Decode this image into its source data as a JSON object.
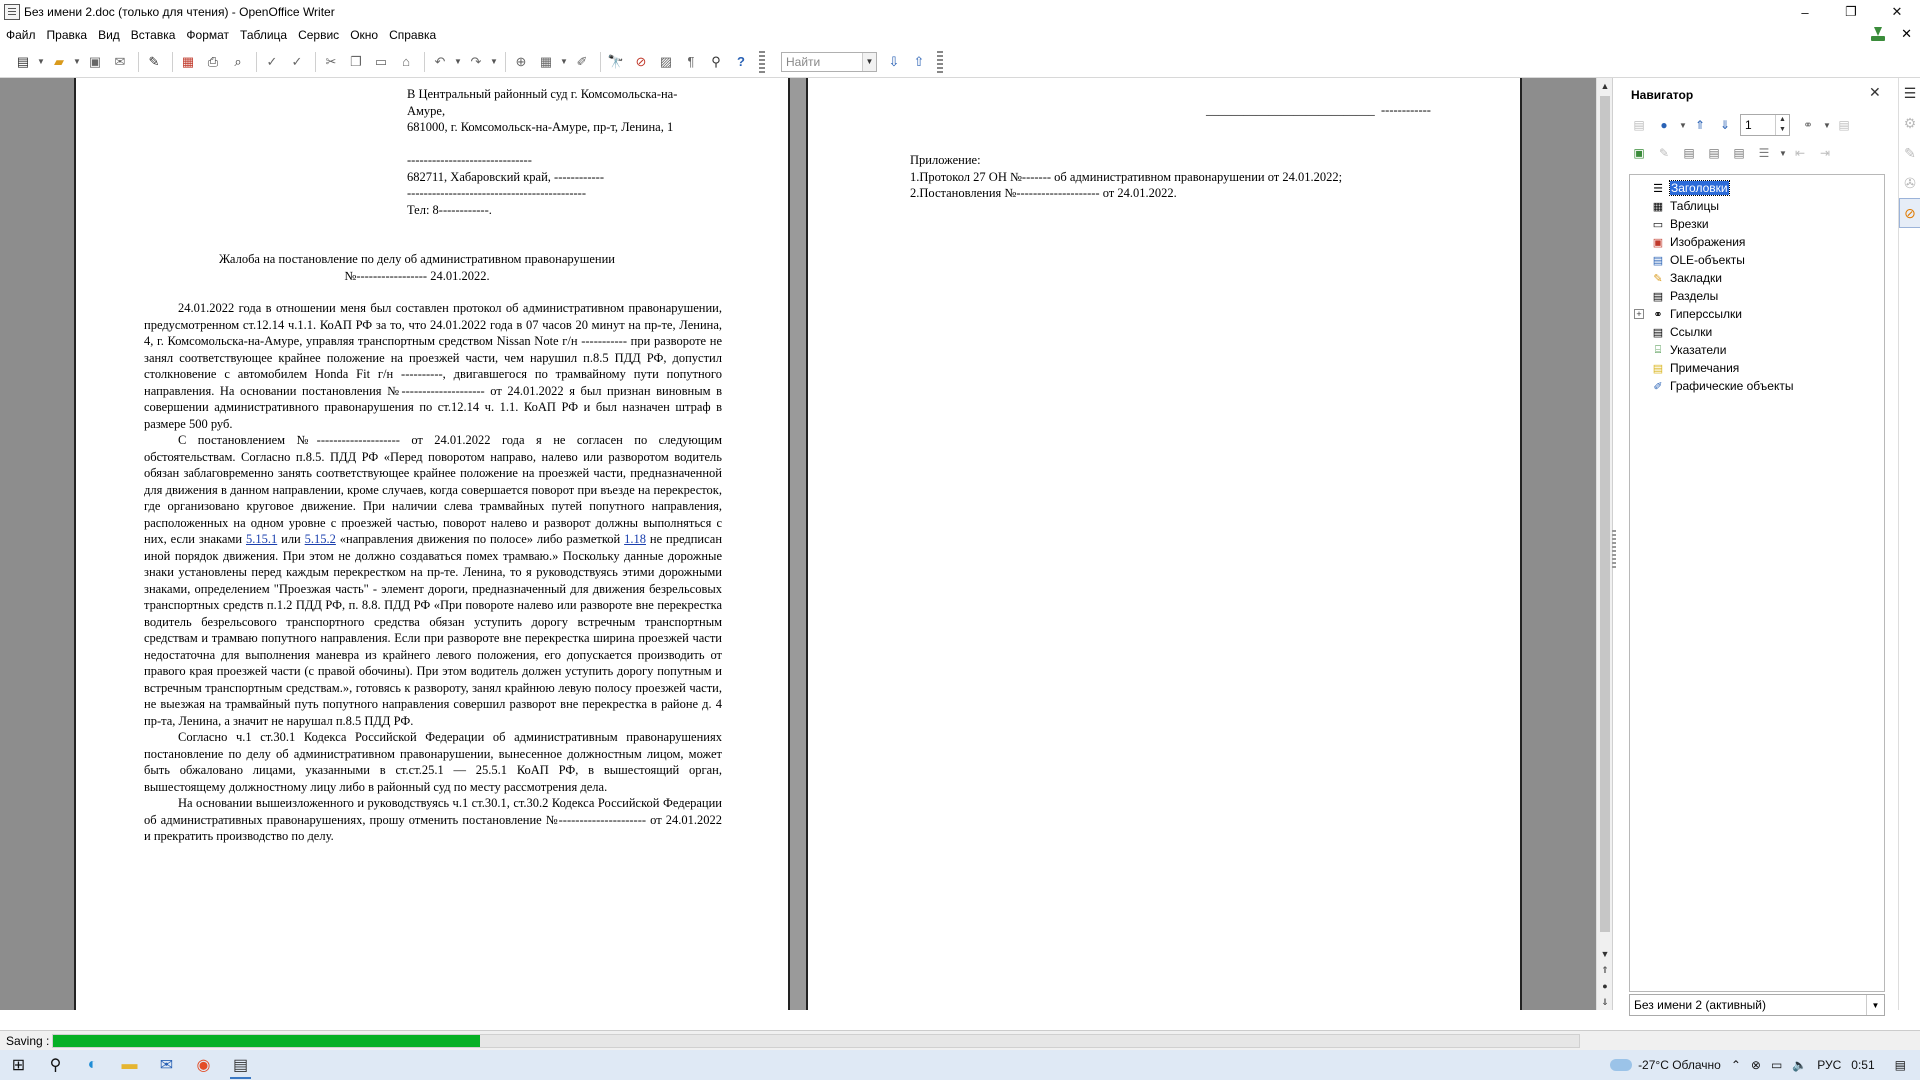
{
  "window": {
    "title": "Без имени 2.doc (только для чтения) - OpenOffice Writer",
    "minimize": "–",
    "maximize": "❐",
    "close": "✕"
  },
  "menu": [
    "Файл",
    "Правка",
    "Вид",
    "Вставка",
    "Формат",
    "Таблица",
    "Сервис",
    "Окно",
    "Справка"
  ],
  "toolbar": {
    "search_placeholder": "Найти"
  },
  "document": {
    "page1": {
      "address": [
        "В Центральный районный суд г. Комсомольска-на-",
        "Амуре,",
        "681000, г. Комсомольск-на-Амуре, пр-т, Ленина, 1",
        "",
        "------------------------------",
        "682711, Хабаровский край, ------------",
        "-------------------------------------------",
        "Тел: 8------------."
      ],
      "heading_line1": "Жалоба на постановление по делу об административном правонарушении",
      "heading_line2": "№----------------- 24.01.2022.",
      "paragraph1": "24.01.2022 года в отношении меня был составлен протокол об административном правонарушении, предусмотренном ст.12.14 ч.1.1. КоАП РФ за то, что 24.01.2022 года в 07 часов 20 минут на пр-те, Ленина, 4, г. Комсомольска-на-Амуре, управляя транспортным средством Nissan Note г/н ----------- при развороте не занял соответствующее крайнее положение на проезжей части, чем нарушил п.8.5 ПДД РФ, допустил столкновение с автомобилем Honda Fit г/н ----------, двигавшегося по трамвайному пути попутного направления. На основании постановления №-------------------- от 24.01.2022 я был признан виновным в совершении административного правонарушения по ст.12.14 ч. 1.1. КоАП РФ и был назначен штраф в размере 500 руб.",
      "paragraph2_a": "С постановлением №-------------------- от 24.01.2022 года я не согласен по следующим обстоятельствам. Согласно п.8.5. ПДД РФ «Перед поворотом направо, налево или разворотом водитель обязан заблаговременно занять соответствующее крайнее положение на проезжей части, предназначенной для движения в данном направлении, кроме случаев, когда совершается поворот при въезде на перекресток, где организовано круговое движение. При наличии слева трамвайных путей попутного направления, расположенных на одном уровне с проезжей частью, поворот налево и разворот должны выполняться с них, если знаками ",
      "link1": "5.15.1",
      "paragraph2_b": " или ",
      "link2": "5.15.2",
      "paragraph2_c": " «направления движения по полосе» либо разметкой ",
      "link3": "1.18",
      "paragraph2_d": " не предписан иной порядок движения. При этом не должно создаваться помех трамваю.» Поскольку данные дорожные знаки установлены перед каждым перекрестком на пр-те. Ленина, то я руководствуясь этими дорожными знаками, определением \"Проезжая часть\" - элемент дороги, предназначенный для движения безрельсовых транспортных средств п.1.2 ПДД РФ, п. 8.8. ПДД РФ «При повороте налево или развороте вне перекрестка водитель безрельсового транспортного средства обязан уступить дорогу встречным транспортным средствам и трамваю попутного направления. Если при развороте вне перекрестка ширина проезжей части недостаточна для выполнения маневра из крайнего левого положения, его допускается производить от правого края проезжей части (с правой обочины). При этом водитель должен уступить дорогу попутным и встречным транспортным средствам.», готовясь к развороту, занял крайнюю левую полосу проезжей части, не выезжая на трамвайный путь попутного направления совершил разворот вне перекрестка в районе д. 4 пр-та, Ленина, а значит не нарушал п.8.5 ПДД РФ.",
      "paragraph3": "Согласно ч.1 ст.30.1 Кодекса Российской Федерации об административным правонарушениях постановление по делу об административном правонарушении, вынесенное должностным лицом, может быть обжаловано лицами, указанными в ст.ст.25.1 — 25.5.1 КоАП РФ, в вышестоящий орган, вышестоящему должностному лицу либо в районный суд по месту рассмотрения дела.",
      "paragraph4": "На основании вышеизложенного и руководствуясь ч.1 ст.30.1, ст.30.2 Кодекса Российской Федерации об административных правонарушениях, прошу отменить постановление №--------------------- от 24.01.2022 и прекратить производство по делу."
    },
    "page2": {
      "signature_line": "___________________________  ------------",
      "attachments_title": "Приложение:",
      "attachment1": "1.Протокол 27 ОН №------- об административном правонарушении от 24.01.2022;",
      "attachment2": "2.Постановления №-------------------- от 24.01.2022."
    }
  },
  "navigator": {
    "title": "Навигатор",
    "page_number": "1",
    "items": [
      {
        "label": "Заголовки",
        "icon": "headings-icon",
        "selected": true
      },
      {
        "label": "Таблицы",
        "icon": "table-icon"
      },
      {
        "label": "Врезки",
        "icon": "frame-icon"
      },
      {
        "label": "Изображения",
        "icon": "image-icon"
      },
      {
        "label": "OLE-объекты",
        "icon": "ole-icon"
      },
      {
        "label": "Закладки",
        "icon": "bookmark-icon"
      },
      {
        "label": "Разделы",
        "icon": "section-icon"
      },
      {
        "label": "Гиперссылки",
        "icon": "hyperlink-icon",
        "expandable": true
      },
      {
        "label": "Ссылки",
        "icon": "reference-icon"
      },
      {
        "label": "Указатели",
        "icon": "index-icon"
      },
      {
        "label": "Примечания",
        "icon": "comment-icon"
      },
      {
        "label": "Графические объекты",
        "icon": "drawing-icon"
      }
    ],
    "document_select": "Без имени 2 (активный)"
  },
  "status": {
    "label": "Saving :",
    "progress": 0.28
  },
  "taskbar": {
    "weather": "-27°C  Облачно",
    "language": "РУС",
    "time": "0:51"
  },
  "colors": {
    "progress": "#06b025",
    "selection": "#2b6ad8",
    "link": "#1a3fae"
  }
}
